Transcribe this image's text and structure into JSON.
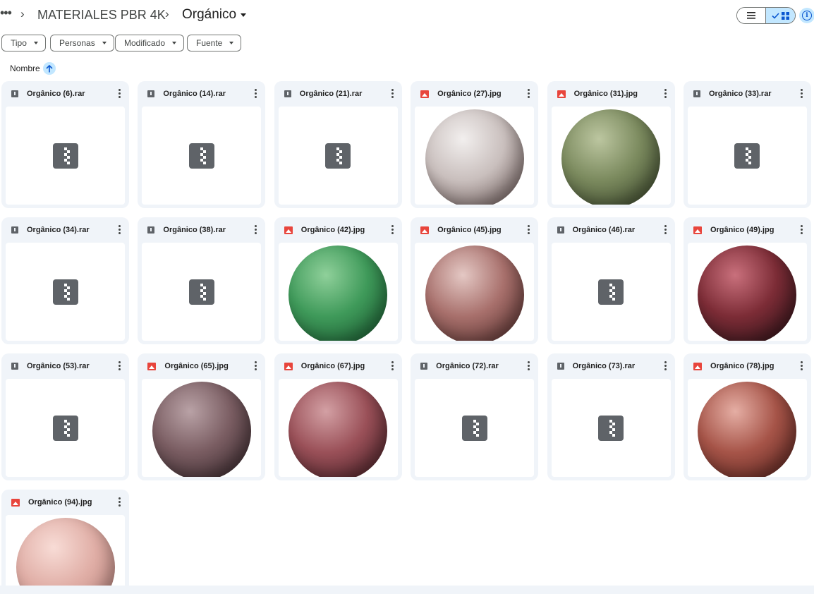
{
  "breadcrumb": {
    "more": "•••",
    "parent": "MATERIALES PBR 4K",
    "current": "Orgánico"
  },
  "view": {
    "list_icon": "list-icon",
    "grid_icon": "grid-icon",
    "active": "grid",
    "info_glyph": "i"
  },
  "filters": [
    "Tipo",
    "Personas",
    "Modificado",
    "Fuente"
  ],
  "sort": {
    "label": "Nombre",
    "direction": "ascending"
  },
  "files": [
    {
      "name": "Orgânico (6).rar",
      "type": "rar"
    },
    {
      "name": "Orgânico (14).rar",
      "type": "rar"
    },
    {
      "name": "Orgânico (21).rar",
      "type": "rar"
    },
    {
      "name": "Orgânico (27).jpg",
      "type": "jpg",
      "colors": [
        "#f2efee",
        "#c9bfbd",
        "#5e4a48"
      ]
    },
    {
      "name": "Orgânico (31).jpg",
      "type": "jpg",
      "colors": [
        "#bcc6a0",
        "#7b8a5e",
        "#2f3a22"
      ]
    },
    {
      "name": "Orgânico (33).rar",
      "type": "rar"
    },
    {
      "name": "Orgânico (34).rar",
      "type": "rar"
    },
    {
      "name": "Orgânico (38).rar",
      "type": "rar"
    },
    {
      "name": "Orgânico (42).jpg",
      "type": "jpg",
      "colors": [
        "#8fd09a",
        "#3f9a5a",
        "#14502a"
      ]
    },
    {
      "name": "Orgânico (45).jpg",
      "type": "jpg",
      "colors": [
        "#e4c8c4",
        "#a8706c",
        "#4a2624"
      ]
    },
    {
      "name": "Orgânico (46).rar",
      "type": "rar"
    },
    {
      "name": "Orgânico (49).jpg",
      "type": "jpg",
      "colors": [
        "#c9707c",
        "#7c2c36",
        "#1e0e12"
      ]
    },
    {
      "name": "Orgânico (53).rar",
      "type": "rar"
    },
    {
      "name": "Orgânico (65).jpg",
      "type": "jpg",
      "colors": [
        "#b9a2a6",
        "#7a5d62",
        "#2c1e22"
      ]
    },
    {
      "name": "Orgânico (67).jpg",
      "type": "jpg",
      "colors": [
        "#d3a0a4",
        "#9a5058",
        "#3a181e"
      ]
    },
    {
      "name": "Orgânico (72).rar",
      "type": "rar"
    },
    {
      "name": "Orgânico (73).rar",
      "type": "rar"
    },
    {
      "name": "Orgânico (78).jpg",
      "type": "jpg",
      "colors": [
        "#e5aea4",
        "#a65448",
        "#4c1c18"
      ]
    },
    {
      "name": "Orgânico (94).jpg",
      "type": "jpg",
      "colors": [
        "#f8dcd6",
        "#e0aea6",
        "#b07a74"
      ]
    }
  ]
}
